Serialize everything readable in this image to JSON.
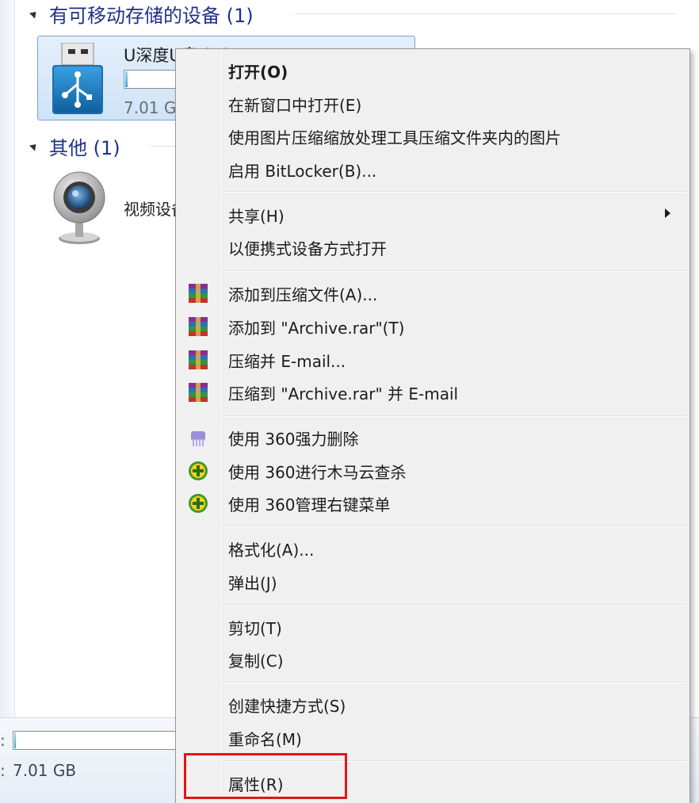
{
  "explorer": {
    "groups": [
      {
        "title": "有可移动存储的设备 (1)"
      },
      {
        "title": "其他 (1)"
      }
    ],
    "usb_device": {
      "name": "U深度U盘 (F:)",
      "free": "7.01 GB 可用，共 7.01 GB",
      "used_fraction": 0.01
    },
    "webcam": {
      "label": "视频设备"
    },
    "details": {
      "label_1": ":",
      "label_2": ":",
      "size": "7.01 GB",
      "used_fraction": 0.01
    }
  },
  "context_menu": {
    "items": [
      {
        "label": "打开(O)",
        "bold": true
      },
      {
        "label": "在新窗口中打开(E)"
      },
      {
        "label": "使用图片压缩缩放处理工具压缩文件夹内的图片"
      },
      {
        "label": "启用 BitLocker(B)..."
      },
      {
        "label": "共享(H)",
        "submenu": true
      },
      {
        "label": "以便携式设备方式打开"
      },
      {
        "label": "添加到压缩文件(A)...",
        "icon": "winrar-icon"
      },
      {
        "label": "添加到 \"Archive.rar\"(T)",
        "icon": "winrar-icon"
      },
      {
        "label": "压缩并 E-mail...",
        "icon": "winrar-icon"
      },
      {
        "label": "压缩到 \"Archive.rar\" 并 E-mail",
        "icon": "winrar-icon"
      },
      {
        "label": "使用 360强力删除",
        "icon": "360-shred-icon"
      },
      {
        "label": "使用 360进行木马云查杀",
        "icon": "360-scan-icon"
      },
      {
        "label": "使用 360管理右键菜单",
        "icon": "360-scan-icon"
      },
      {
        "label": "格式化(A)..."
      },
      {
        "label": "弹出(J)"
      },
      {
        "label": "剪切(T)"
      },
      {
        "label": "复制(C)"
      },
      {
        "label": "创建快捷方式(S)"
      },
      {
        "label": "重命名(M)"
      },
      {
        "label": "属性(R)",
        "highlighted": true
      }
    ],
    "highlight_color": "#e01818"
  },
  "colors": {
    "group_title": "#1e3287",
    "selection_border": "#7da2ce",
    "menu_background": "#f0f0f0"
  }
}
